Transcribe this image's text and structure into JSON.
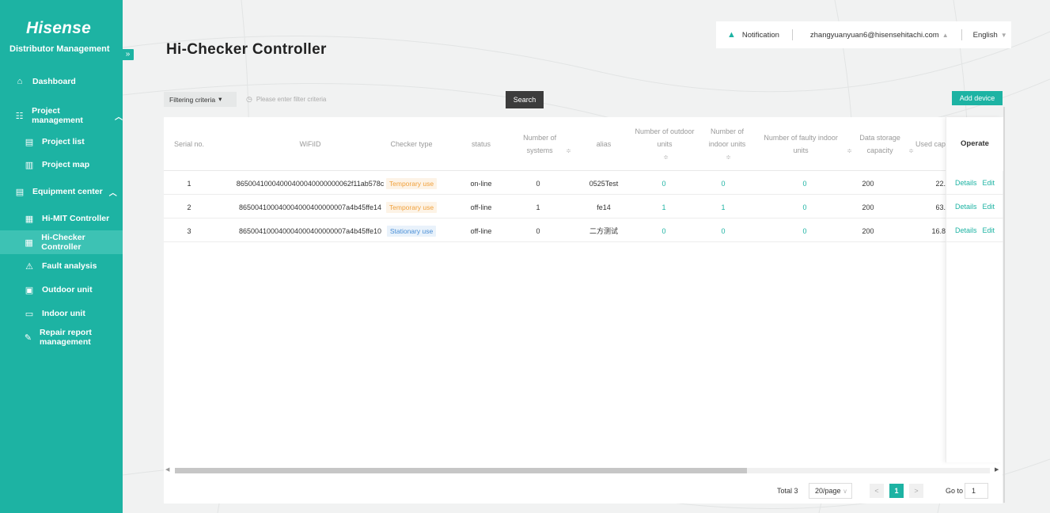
{
  "sidebar": {
    "brand": "Hisense",
    "subtitle": "Distributor Management",
    "collapse_icon": "»",
    "items": [
      {
        "label": "Dashboard",
        "icon": "⌂"
      },
      {
        "label": "Project management",
        "icon": "☷",
        "chevron": "︿"
      },
      {
        "label": "Project list",
        "icon": "▤"
      },
      {
        "label": "Project map",
        "icon": "▥"
      },
      {
        "label": "Equipment center",
        "icon": "▤",
        "chevron": "︿"
      },
      {
        "label": "Hi-MIT Controller",
        "icon": "▦"
      },
      {
        "label": "Hi-Checker Controller",
        "icon": "▦"
      },
      {
        "label": "Fault analysis",
        "icon": "⚠"
      },
      {
        "label": "Outdoor unit",
        "icon": "▣"
      },
      {
        "label": "Indoor unit",
        "icon": "▭"
      },
      {
        "label": "Repair report management",
        "icon": "✎"
      }
    ],
    "active": "Hi-Checker Controller"
  },
  "header": {
    "title": "Hi-Checker Controller",
    "notification": "Notification",
    "user": "zhangyuanyuan6@hisensehitachi.com",
    "user_caret": "▲",
    "language": "English",
    "language_caret": "▼"
  },
  "filter": {
    "criteria_label": "Filtering criteria",
    "criteria_caret": "▾",
    "placeholder": "Please enter filter criteria",
    "search_label": "Search",
    "add_label": "Add device"
  },
  "table": {
    "columns": [
      {
        "label": "Serial no.",
        "sortable": false
      },
      {
        "label": "WiFiID",
        "sortable": false
      },
      {
        "label": "Checker type",
        "sortable": false
      },
      {
        "label": "status",
        "sortable": false
      },
      {
        "label": "Number of systems",
        "sortable": true
      },
      {
        "label": "alias",
        "sortable": false
      },
      {
        "label": "Number of outdoor units",
        "sortable": true
      },
      {
        "label": "Number of indoor units",
        "sortable": true
      },
      {
        "label": "Number of faulty indoor units",
        "sortable": true
      },
      {
        "label": "Data storage capacity",
        "sortable": true
      },
      {
        "label": "Used capa",
        "sortable": false
      },
      {
        "label": "Operate",
        "sortable": false
      }
    ],
    "sort_icon": "≑",
    "rows": [
      {
        "serial": "1",
        "wifi": "86500410004000400040000000062f11ab578c",
        "type": "Temporary use",
        "type_kind": "temp",
        "status": "on-line",
        "systems": "0",
        "alias": "0525Test",
        "outdoor": "0",
        "indoor": "0",
        "faulty": "0",
        "storage": "200",
        "used": "22.",
        "details": "Details",
        "edit": "Edit"
      },
      {
        "serial": "2",
        "wifi": "865004100040004000400000007a4b45ffe14",
        "type": "Temporary use",
        "type_kind": "temp",
        "status": "off-line",
        "systems": "1",
        "alias": "fe14",
        "outdoor": "1",
        "indoor": "1",
        "faulty": "0",
        "storage": "200",
        "used": "63.",
        "details": "Details",
        "edit": "Edit"
      },
      {
        "serial": "3",
        "wifi": "865004100040004000400000007a4b45ffe10",
        "type": "Stationary use",
        "type_kind": "stat",
        "status": "off-line",
        "systems": "0",
        "alias": "二方测试",
        "outdoor": "0",
        "indoor": "0",
        "faulty": "0",
        "storage": "200",
        "used": "16.8",
        "details": "Details",
        "edit": "Edit"
      }
    ]
  },
  "pagination": {
    "total": "Total 3",
    "page_size": "20/page",
    "current": "1",
    "prev": "<",
    "next": ">",
    "goto_label": "Go to",
    "goto_value": "1"
  },
  "colors": {
    "accent": "#1db3a3",
    "search_button": "#3c3c3c"
  }
}
